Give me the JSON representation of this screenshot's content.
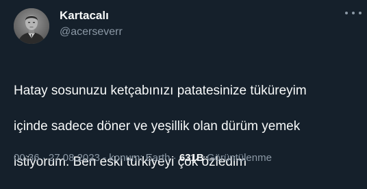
{
  "author": {
    "display_name": "Kartacalı",
    "handle": "@acerseverr",
    "avatar_icon": "profile-photo"
  },
  "tweet": {
    "text_lines": [
      "Hatay sosunuzu ketçabınızı patatesinize tüküreyim",
      "içinde sadece döner ve yeşillik olan dürüm yemek",
      "istiyorum. Ben eski türkiyeyi çok özledim"
    ]
  },
  "meta": {
    "time": "00:36",
    "separator1": " · ",
    "date": "27.08.2023",
    "location": " - konum: Earth",
    "separator2": " · ",
    "views_count": "631B",
    "views_label": " Görüntülenme"
  },
  "colors": {
    "background": "#15202b",
    "primary_text": "#f7f9f9",
    "secondary_text": "#8b98a5"
  },
  "icons": {
    "more": "more-horizontal-icon"
  }
}
